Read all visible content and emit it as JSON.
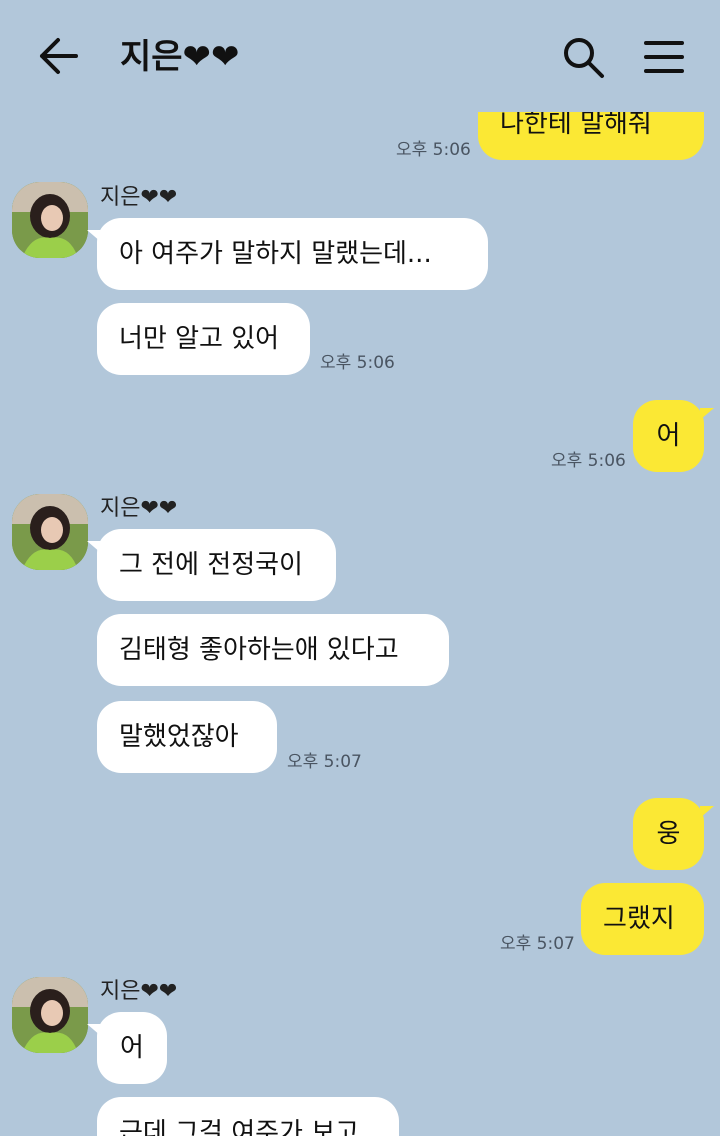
{
  "header": {
    "title": "지은❤❤"
  },
  "friend": {
    "name": "지은❤❤"
  },
  "messages": {
    "m0": "나한테 말해줘",
    "t0": "오후 5:06",
    "m1": "아 여주가 말하지 말랬는데...",
    "m2": "너만 알고 있어",
    "t1": "오후 5:06",
    "m3": "어",
    "t2": "오후 5:06",
    "m4": "그 전에 전정국이",
    "m5": "김태형 좋아하는애 있다고",
    "m6": "말했었잖아",
    "t3": "오후 5:07",
    "m7": "웅",
    "m8": "그랬지",
    "t4": "오후 5:07",
    "m9": "어",
    "m10": "근데 그걸 여주가 보고"
  }
}
